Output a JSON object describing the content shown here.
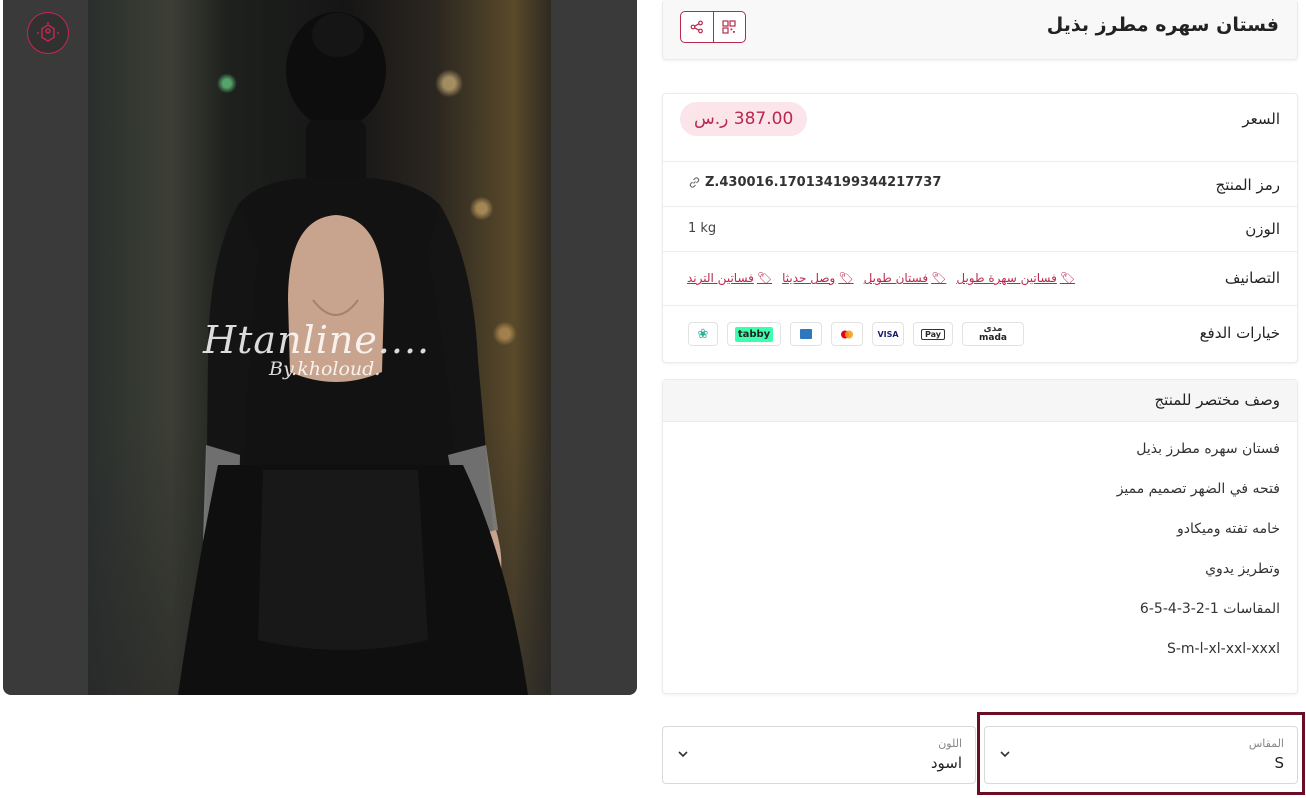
{
  "product": {
    "title": "فستان سهره مطرز بذيل",
    "price_label": "السعر",
    "price": "387.00 ر.س",
    "sku_label": "رمز المنتج",
    "sku": "Z.430016.170134199344217737",
    "weight_label": "الوزن",
    "weight": "1 kg",
    "categories_label": "التصانيف",
    "categories": [
      "فساتين سهرة طويل",
      "فستان طويل",
      "وصل حديثا",
      "فساتين الترند"
    ],
    "payment_label": "خيارات الدفع",
    "payment_methods": [
      "mada",
      "Apple Pay",
      "VISA",
      "Mastercard",
      "American Express",
      "tabby",
      "tamara"
    ]
  },
  "payment_text": {
    "mada_ar": "مدى",
    "mada_en": "mada",
    "applepay": "Pay",
    "visa": "VISA",
    "tabby": "tabby"
  },
  "image": {
    "watermark_line1": "Htanline....",
    "watermark_line2": "By.kholoud."
  },
  "description": {
    "heading": "وصف مختصر للمنتج",
    "lines": [
      "فستان سهره مطرز بذيل",
      "فتحه في الضهر تصميم مميز",
      "خامه تفته وميكادو",
      "وتطريز يدوي",
      "المقاسات 1-2-3-4-5-6",
      "S-m-l-xl-xxl-xxxl"
    ]
  },
  "options": {
    "size": {
      "label": "المقاس",
      "value": "S"
    },
    "color": {
      "label": "اللون",
      "value": "اسود"
    }
  },
  "colors": {
    "accent": "#b8294e",
    "price_bg": "#fbe4ea",
    "highlight_border": "#6b0d24"
  }
}
